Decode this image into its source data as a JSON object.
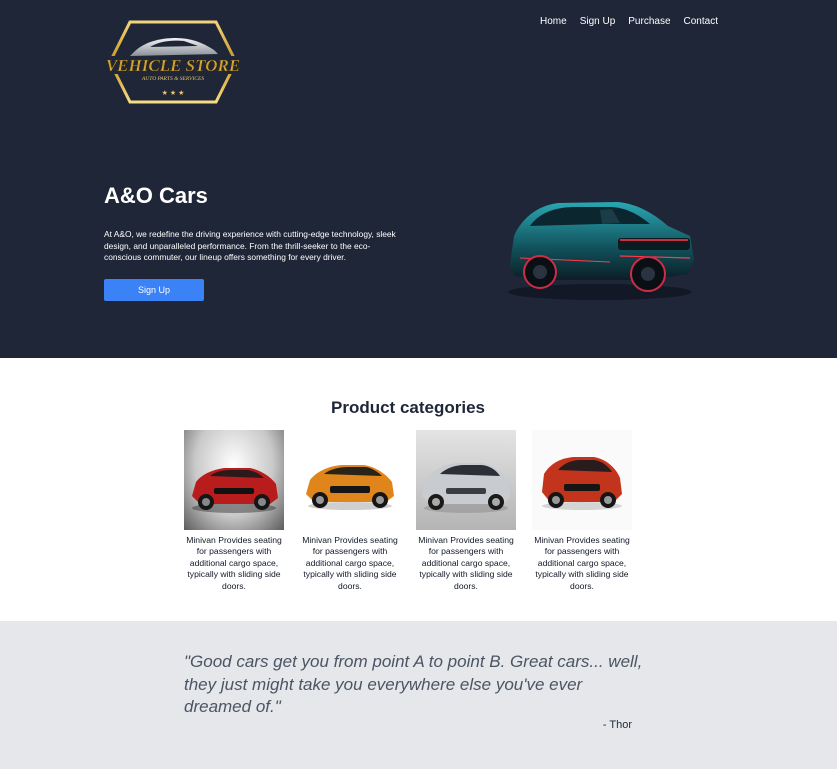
{
  "logo": {
    "name": "VEHICLE STORE",
    "tagline": "AUTO PARTS & SERVICES"
  },
  "nav": {
    "items": [
      {
        "label": "Home"
      },
      {
        "label": "Sign Up"
      },
      {
        "label": "Purchase"
      },
      {
        "label": "Contact"
      }
    ]
  },
  "hero": {
    "title": "A&O Cars",
    "description": "At A&O, we redefine the driving experience with cutting-edge technology, sleek design, and unparalleled performance. From the thrill-seeker to the eco-conscious commuter, our lineup offers something for every driver.",
    "button_label": "Sign Up"
  },
  "categories": {
    "title": "Product categories",
    "items": [
      {
        "text": "Minivan Provides seating for passengers with additional cargo space, typically with sliding side doors.",
        "color": "#b91c1c"
      },
      {
        "text": "Minivan Provides seating for passengers with additional cargo space, typically with sliding side doors.",
        "color": "#e0851c"
      },
      {
        "text": "Minivan Provides seating for passengers with additional cargo space, typically with sliding side doors.",
        "color": "#c8ccd0"
      },
      {
        "text": "Minivan Provides seating for passengers with additional cargo space, typically with sliding side doors.",
        "color": "#c2341c"
      }
    ]
  },
  "quote": {
    "text": "\"Good cars get you from point A to point B. Great cars... well, they just might take you everywhere else you've ever dreamed of.\"",
    "author": "- Thor"
  },
  "colors": {
    "hero_bg": "#1f2637",
    "accent": "#3b82f6",
    "quote_bg": "#e5e7eb"
  }
}
